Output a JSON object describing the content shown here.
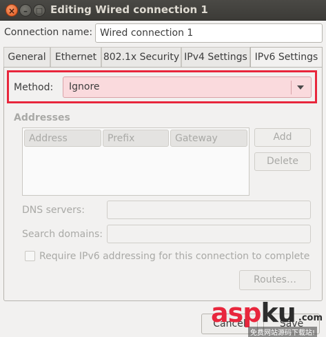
{
  "window": {
    "title": "Editing Wired connection 1",
    "close_glyph": "×",
    "minimize_glyph": "–",
    "maximize_glyph": "□"
  },
  "connection": {
    "name_label": "Connection name:",
    "name_value": "Wired connection 1"
  },
  "tabs": [
    {
      "label": "General"
    },
    {
      "label": "Ethernet"
    },
    {
      "label": "802.1x Security"
    },
    {
      "label": "IPv4 Settings"
    },
    {
      "label": "IPv6 Settings",
      "active": true
    }
  ],
  "ipv6": {
    "method_label": "Method:",
    "method_value": "Ignore",
    "addresses_heading": "Addresses",
    "columns": [
      "Address",
      "Prefix",
      "Gateway"
    ],
    "add_label": "Add",
    "delete_label": "Delete",
    "dns_label": "DNS servers:",
    "dns_value": "",
    "search_label": "Search domains:",
    "search_value": "",
    "require_label": "Require IPv6 addressing for this connection to complete",
    "require_checked": false,
    "routes_label": "Routes…"
  },
  "footer": {
    "cancel_label": "Cancel",
    "save_label": "Save"
  },
  "watermark": {
    "part1": "asp",
    "part2": "ku",
    "domain": ".com",
    "subtitle": "免费网站源码下载站!"
  },
  "colors": {
    "highlight": "#e8263c",
    "titlebar": "#3c3b37",
    "close_button": "#e2561c"
  }
}
